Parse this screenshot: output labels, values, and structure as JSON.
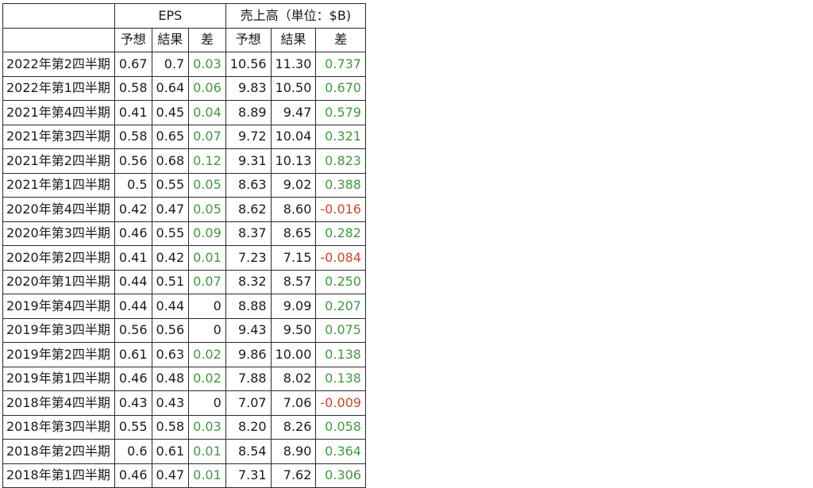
{
  "header": {
    "group_eps": "EPS",
    "group_revenue": "売上高（単位：$B)",
    "sub_forecast": "予想",
    "sub_result": "結果",
    "sub_diff": "差"
  },
  "rows": [
    {
      "period": "2022年第2四半期",
      "eps_f": "0.67",
      "eps_r": "0.7",
      "eps_d": "0.03",
      "rev_f": "10.56",
      "rev_r": "11.30",
      "rev_d": "0.737"
    },
    {
      "period": "2022年第1四半期",
      "eps_f": "0.58",
      "eps_r": "0.64",
      "eps_d": "0.06",
      "rev_f": "9.83",
      "rev_r": "10.50",
      "rev_d": "0.670"
    },
    {
      "period": "2021年第4四半期",
      "eps_f": "0.41",
      "eps_r": "0.45",
      "eps_d": "0.04",
      "rev_f": "8.89",
      "rev_r": "9.47",
      "rev_d": "0.579"
    },
    {
      "period": "2021年第3四半期",
      "eps_f": "0.58",
      "eps_r": "0.65",
      "eps_d": "0.07",
      "rev_f": "9.72",
      "rev_r": "10.04",
      "rev_d": "0.321"
    },
    {
      "period": "2021年第2四半期",
      "eps_f": "0.56",
      "eps_r": "0.68",
      "eps_d": "0.12",
      "rev_f": "9.31",
      "rev_r": "10.13",
      "rev_d": "0.823"
    },
    {
      "period": "2021年第1四半期",
      "eps_f": "0.5",
      "eps_r": "0.55",
      "eps_d": "0.05",
      "rev_f": "8.63",
      "rev_r": "9.02",
      "rev_d": "0.388"
    },
    {
      "period": "2020年第4四半期",
      "eps_f": "0.42",
      "eps_r": "0.47",
      "eps_d": "0.05",
      "rev_f": "8.62",
      "rev_r": "8.60",
      "rev_d": "-0.016"
    },
    {
      "period": "2020年第3四半期",
      "eps_f": "0.46",
      "eps_r": "0.55",
      "eps_d": "0.09",
      "rev_f": "8.37",
      "rev_r": "8.65",
      "rev_d": "0.282"
    },
    {
      "period": "2020年第2四半期",
      "eps_f": "0.41",
      "eps_r": "0.42",
      "eps_d": "0.01",
      "rev_f": "7.23",
      "rev_r": "7.15",
      "rev_d": "-0.084"
    },
    {
      "period": "2020年第1四半期",
      "eps_f": "0.44",
      "eps_r": "0.51",
      "eps_d": "0.07",
      "rev_f": "8.32",
      "rev_r": "8.57",
      "rev_d": "0.250"
    },
    {
      "period": "2019年第4四半期",
      "eps_f": "0.44",
      "eps_r": "0.44",
      "eps_d": "0",
      "rev_f": "8.88",
      "rev_r": "9.09",
      "rev_d": "0.207"
    },
    {
      "period": "2019年第3四半期",
      "eps_f": "0.56",
      "eps_r": "0.56",
      "eps_d": "0",
      "rev_f": "9.43",
      "rev_r": "9.50",
      "rev_d": "0.075"
    },
    {
      "period": "2019年第2四半期",
      "eps_f": "0.61",
      "eps_r": "0.63",
      "eps_d": "0.02",
      "rev_f": "9.86",
      "rev_r": "10.00",
      "rev_d": "0.138"
    },
    {
      "period": "2019年第1四半期",
      "eps_f": "0.46",
      "eps_r": "0.48",
      "eps_d": "0.02",
      "rev_f": "7.88",
      "rev_r": "8.02",
      "rev_d": "0.138"
    },
    {
      "period": "2018年第4四半期",
      "eps_f": "0.43",
      "eps_r": "0.43",
      "eps_d": "0",
      "rev_f": "7.07",
      "rev_r": "7.06",
      "rev_d": "-0.009"
    },
    {
      "period": "2018年第3四半期",
      "eps_f": "0.55",
      "eps_r": "0.58",
      "eps_d": "0.03",
      "rev_f": "8.20",
      "rev_r": "8.26",
      "rev_d": "0.058"
    },
    {
      "period": "2018年第2四半期",
      "eps_f": "0.6",
      "eps_r": "0.61",
      "eps_d": "0.01",
      "rev_f": "8.54",
      "rev_r": "8.90",
      "rev_d": "0.364"
    },
    {
      "period": "2018年第1四半期",
      "eps_f": "0.46",
      "eps_r": "0.47",
      "eps_d": "0.01",
      "rev_f": "7.31",
      "rev_r": "7.62",
      "rev_d": "0.306"
    }
  ],
  "colors": {
    "positive": "#3f9a3f",
    "negative": "#d9412b",
    "neutral": "#1a1a1a",
    "border": "#2b2b2b"
  }
}
